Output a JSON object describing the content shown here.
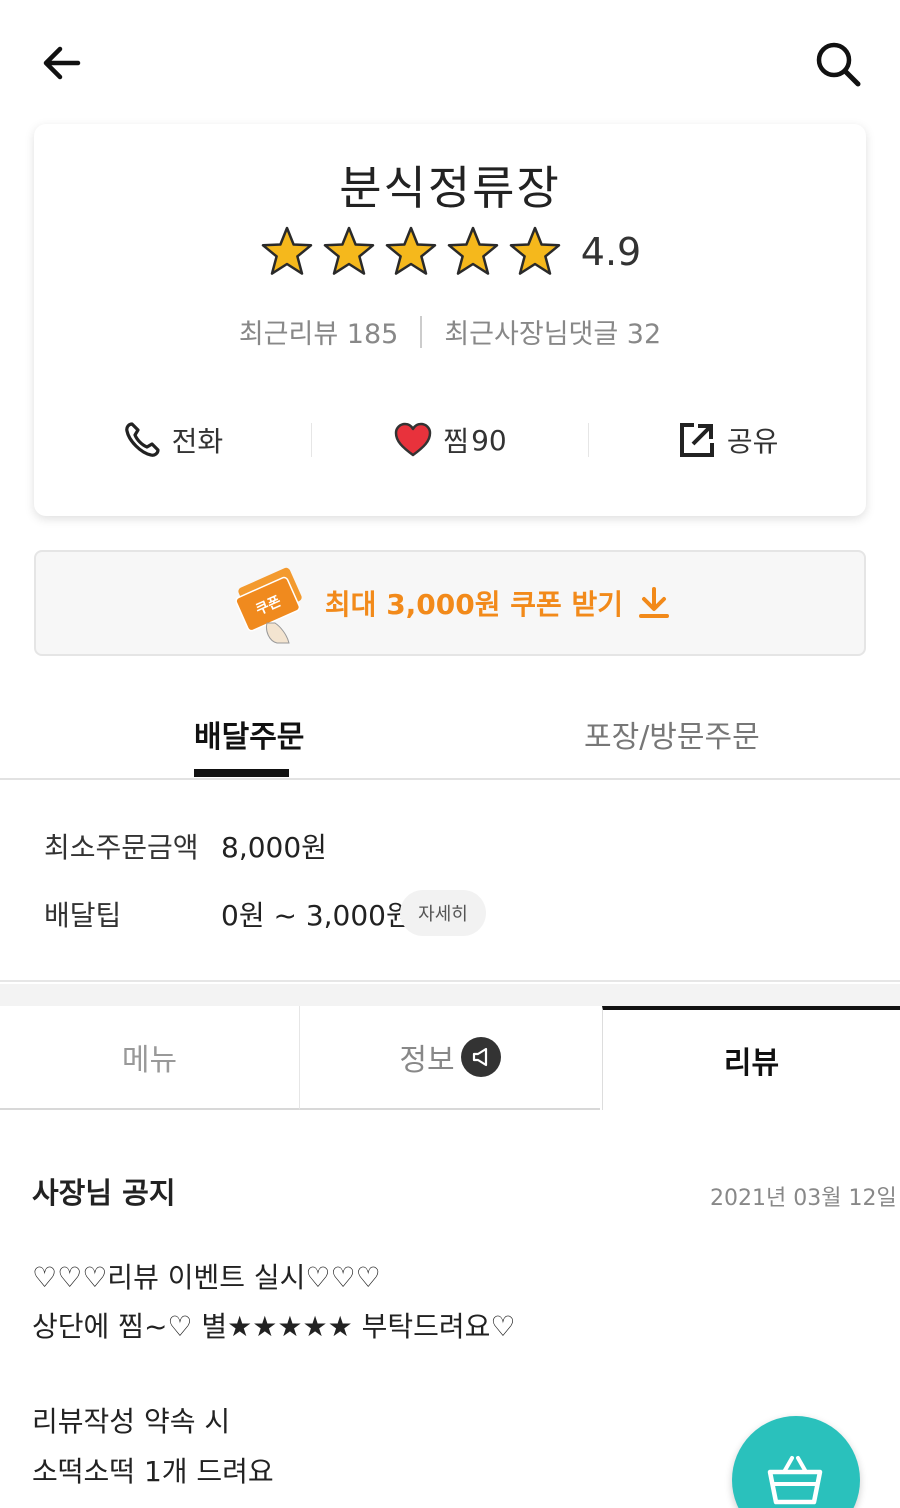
{
  "header": {
    "back_icon": "arrow-left-icon",
    "search_icon": "search-icon"
  },
  "store": {
    "name": "분식정류장",
    "rating": "4.9",
    "rating_stars": 5,
    "recent_reviews": "최근리뷰 185",
    "owner_replies": "최근사장님댓글 32",
    "actions": {
      "call_label": "전화",
      "like_label": "찜",
      "like_count": "90",
      "share_label": "공유"
    }
  },
  "coupon": {
    "badge_text": "쿠폰",
    "label": "최대 3,000원 쿠폰 받기"
  },
  "order_tabs": {
    "delivery": "배달주문",
    "pickup": "포장/방문주문"
  },
  "delivery_info": {
    "min_order_label": "최소주문금액",
    "min_order_value": "8,000원",
    "tip_label": "배달팁",
    "tip_value": "0원 ~ 3,000원",
    "detail_button": "자세히"
  },
  "main_tabs": {
    "menu": "메뉴",
    "info": "정보",
    "review": "리뷰"
  },
  "notice": {
    "title": "사장님 공지",
    "date": "2021년 03월 12일",
    "lines": [
      "♡♡♡리뷰 이벤트 실시♡♡♡",
      "상단에 찜~♡ 별★★★★★ 부탁드려요♡",
      "리뷰작성 약속 시",
      "소떡소떡 1개 드려요"
    ]
  },
  "colors": {
    "accent": "#2ac1bc",
    "coupon": "#f28a1a",
    "star": "#f5b81c",
    "heart": "#e8323c"
  }
}
